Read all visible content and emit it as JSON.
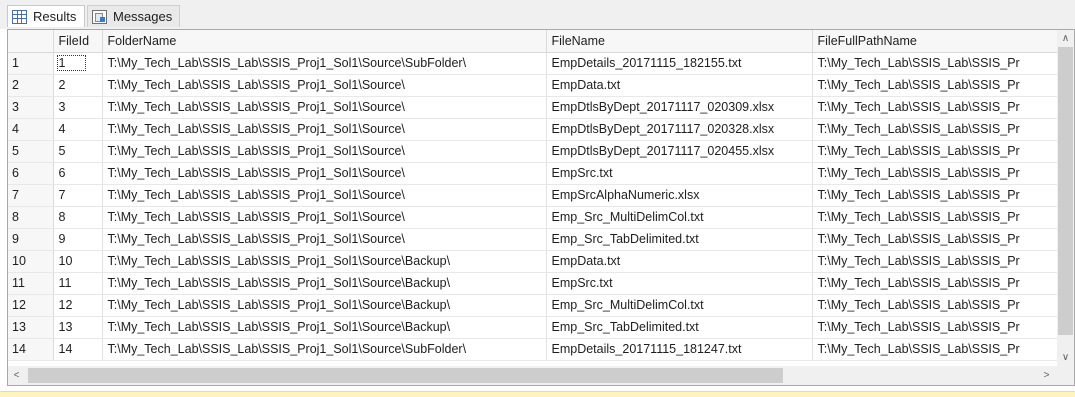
{
  "tabs": {
    "results": "Results",
    "messages": "Messages"
  },
  "grid": {
    "columns": [
      "FileId",
      "FolderName",
      "FileName",
      "FileFullPathName"
    ],
    "rows": [
      {
        "rownum": "1",
        "fileid": "1",
        "folder": "T:\\My_Tech_Lab\\SSIS_Lab\\SSIS_Proj1_Sol1\\Source\\SubFolder\\",
        "file": "EmpDetails_20171115_182155.txt",
        "full": "T:\\My_Tech_Lab\\SSIS_Lab\\SSIS_Pr"
      },
      {
        "rownum": "2",
        "fileid": "2",
        "folder": "T:\\My_Tech_Lab\\SSIS_Lab\\SSIS_Proj1_Sol1\\Source\\",
        "file": "EmpData.txt",
        "full": "T:\\My_Tech_Lab\\SSIS_Lab\\SSIS_Pr"
      },
      {
        "rownum": "3",
        "fileid": "3",
        "folder": "T:\\My_Tech_Lab\\SSIS_Lab\\SSIS_Proj1_Sol1\\Source\\",
        "file": "EmpDtlsByDept_20171117_020309.xlsx",
        "full": "T:\\My_Tech_Lab\\SSIS_Lab\\SSIS_Pr"
      },
      {
        "rownum": "4",
        "fileid": "4",
        "folder": "T:\\My_Tech_Lab\\SSIS_Lab\\SSIS_Proj1_Sol1\\Source\\",
        "file": "EmpDtlsByDept_20171117_020328.xlsx",
        "full": "T:\\My_Tech_Lab\\SSIS_Lab\\SSIS_Pr"
      },
      {
        "rownum": "5",
        "fileid": "5",
        "folder": "T:\\My_Tech_Lab\\SSIS_Lab\\SSIS_Proj1_Sol1\\Source\\",
        "file": "EmpDtlsByDept_20171117_020455.xlsx",
        "full": "T:\\My_Tech_Lab\\SSIS_Lab\\SSIS_Pr"
      },
      {
        "rownum": "6",
        "fileid": "6",
        "folder": "T:\\My_Tech_Lab\\SSIS_Lab\\SSIS_Proj1_Sol1\\Source\\",
        "file": "EmpSrc.txt",
        "full": "T:\\My_Tech_Lab\\SSIS_Lab\\SSIS_Pr"
      },
      {
        "rownum": "7",
        "fileid": "7",
        "folder": "T:\\My_Tech_Lab\\SSIS_Lab\\SSIS_Proj1_Sol1\\Source\\",
        "file": "EmpSrcAlphaNumeric.xlsx",
        "full": "T:\\My_Tech_Lab\\SSIS_Lab\\SSIS_Pr"
      },
      {
        "rownum": "8",
        "fileid": "8",
        "folder": "T:\\My_Tech_Lab\\SSIS_Lab\\SSIS_Proj1_Sol1\\Source\\",
        "file": "Emp_Src_MultiDelimCol.txt",
        "full": "T:\\My_Tech_Lab\\SSIS_Lab\\SSIS_Pr"
      },
      {
        "rownum": "9",
        "fileid": "9",
        "folder": "T:\\My_Tech_Lab\\SSIS_Lab\\SSIS_Proj1_Sol1\\Source\\",
        "file": "Emp_Src_TabDelimited.txt",
        "full": "T:\\My_Tech_Lab\\SSIS_Lab\\SSIS_Pr"
      },
      {
        "rownum": "10",
        "fileid": "10",
        "folder": "T:\\My_Tech_Lab\\SSIS_Lab\\SSIS_Proj1_Sol1\\Source\\Backup\\",
        "file": "EmpData.txt",
        "full": "T:\\My_Tech_Lab\\SSIS_Lab\\SSIS_Pr"
      },
      {
        "rownum": "11",
        "fileid": "11",
        "folder": "T:\\My_Tech_Lab\\SSIS_Lab\\SSIS_Proj1_Sol1\\Source\\Backup\\",
        "file": "EmpSrc.txt",
        "full": "T:\\My_Tech_Lab\\SSIS_Lab\\SSIS_Pr"
      },
      {
        "rownum": "12",
        "fileid": "12",
        "folder": "T:\\My_Tech_Lab\\SSIS_Lab\\SSIS_Proj1_Sol1\\Source\\Backup\\",
        "file": "Emp_Src_MultiDelimCol.txt",
        "full": "T:\\My_Tech_Lab\\SSIS_Lab\\SSIS_Pr"
      },
      {
        "rownum": "13",
        "fileid": "13",
        "folder": "T:\\My_Tech_Lab\\SSIS_Lab\\SSIS_Proj1_Sol1\\Source\\Backup\\",
        "file": "Emp_Src_TabDelimited.txt",
        "full": "T:\\My_Tech_Lab\\SSIS_Lab\\SSIS_Pr"
      },
      {
        "rownum": "14",
        "fileid": "14",
        "folder": "T:\\My_Tech_Lab\\SSIS_Lab\\SSIS_Proj1_Sol1\\Source\\SubFolder\\",
        "file": "EmpDetails_20171115_181247.txt",
        "full": "T:\\My_Tech_Lab\\SSIS_Lab\\SSIS_Pr"
      }
    ]
  },
  "scrollbars": {
    "up_icon": "chevron-up-icon",
    "down_icon": "chevron-down-icon",
    "left_icon": "chevron-left-icon",
    "right_icon": "chevron-right-icon"
  },
  "colors": {
    "selection_outline": "#333333",
    "statusbar": "#fdf4bf"
  }
}
